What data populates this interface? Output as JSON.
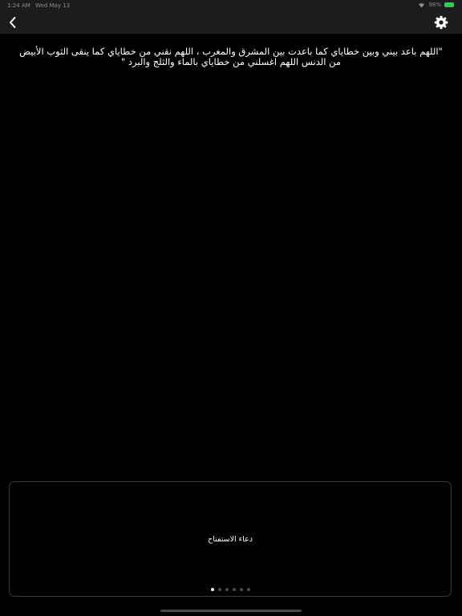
{
  "status_bar": {
    "time": "1:24 AM",
    "date": "Wed May 13",
    "battery": "98%"
  },
  "nav": {
    "back_icon": "chevron-left-icon",
    "settings_icon": "gear-icon"
  },
  "dua": {
    "text": "\"اللهم باعد بيني وبين خطاياي كما باعدت بين المشرق والمغرب ، اللهم نقني من خطاياي كما ينقى الثوب الأبيض من الدنس اللهم اغسلني من خطاياي بالماء والثلج والبرد \""
  },
  "card": {
    "title": "دعاء الاستفتاح",
    "page_count": 6,
    "current_page": 1
  },
  "colors": {
    "background": "#000000",
    "bar": "#1c1c1e",
    "card_border": "#3a3a3c",
    "battery": "#34c759"
  }
}
